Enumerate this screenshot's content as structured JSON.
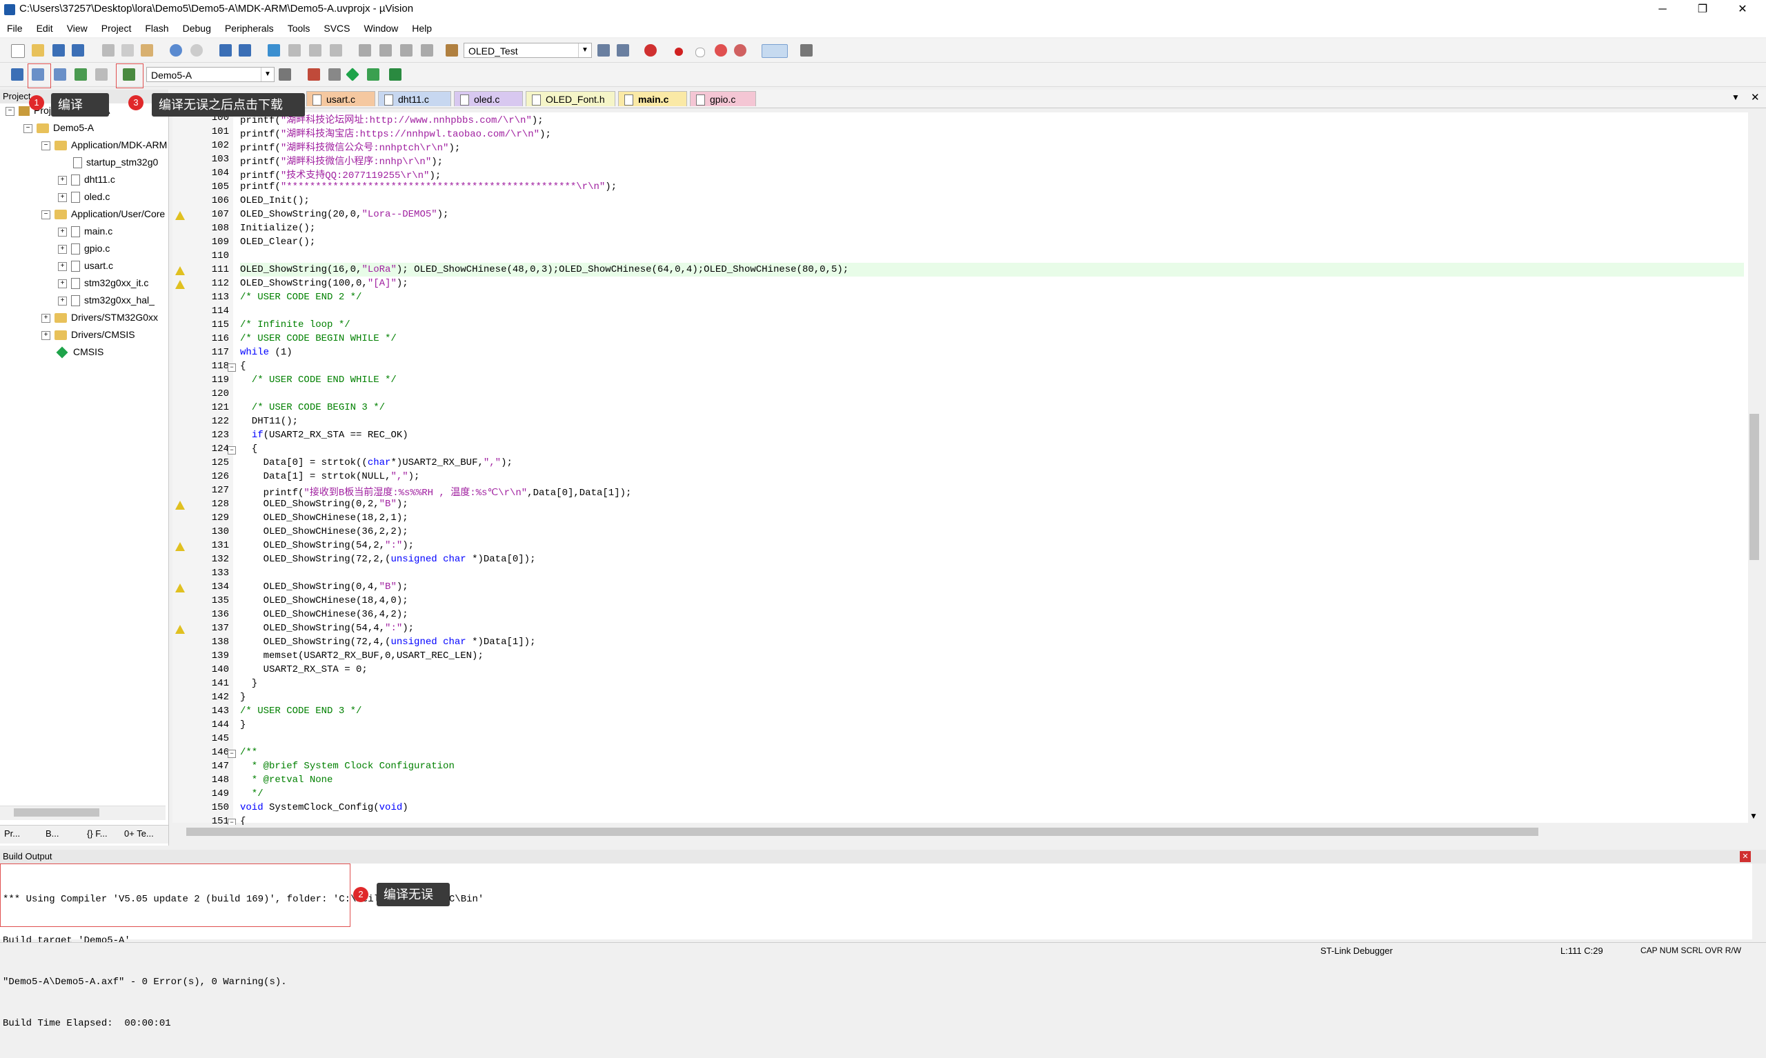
{
  "window": {
    "title": "C:\\Users\\37257\\Desktop\\lora\\Demo5\\Demo5-A\\MDK-ARM\\Demo5-A.uvprojx - µVision",
    "minimize": "─",
    "maximize": "❐",
    "close": "✕"
  },
  "menu": [
    "File",
    "Edit",
    "View",
    "Project",
    "Flash",
    "Debug",
    "Peripherals",
    "Tools",
    "SVCS",
    "Window",
    "Help"
  ],
  "toolbar1": {
    "target_combo": "OLED_Test"
  },
  "toolbar2": {
    "project_combo": "Demo5-A"
  },
  "project_panel": {
    "header": "Project",
    "tree": [
      {
        "label": "Project: Demo5-A",
        "level": 0,
        "type": "project"
      },
      {
        "label": "Demo5-A",
        "level": 1,
        "type": "folder"
      },
      {
        "label": "Application/MDK-ARM",
        "level": 2,
        "type": "folder"
      },
      {
        "label": "startup_stm32g0",
        "level": 3,
        "type": "file"
      },
      {
        "label": "dht11.c",
        "level": 3,
        "type": "file"
      },
      {
        "label": "oled.c",
        "level": 3,
        "type": "file"
      },
      {
        "label": "Application/User/Core",
        "level": 2,
        "type": "folder"
      },
      {
        "label": "main.c",
        "level": 3,
        "type": "file"
      },
      {
        "label": "gpio.c",
        "level": 3,
        "type": "file"
      },
      {
        "label": "usart.c",
        "level": 3,
        "type": "file"
      },
      {
        "label": "stm32g0xx_it.c",
        "level": 3,
        "type": "file"
      },
      {
        "label": "stm32g0xx_hal_",
        "level": 3,
        "type": "file"
      },
      {
        "label": "Drivers/STM32G0xx",
        "level": 2,
        "type": "folder"
      },
      {
        "label": "Drivers/CMSIS",
        "level": 2,
        "type": "folder"
      },
      {
        "label": "CMSIS",
        "level": 2,
        "type": "cmsis"
      }
    ],
    "bottom_tabs": [
      "Pr...",
      "B...",
      "{} F...",
      "0+ Te..."
    ]
  },
  "editor_tabs": [
    {
      "label": "usart.c",
      "color": "#f5c8a0",
      "active": false
    },
    {
      "label": "dht11.c",
      "color": "#c7d7f0",
      "active": false
    },
    {
      "label": "oled.c",
      "color": "#d8c8f0",
      "active": false
    },
    {
      "label": "OLED_Font.h",
      "color": "#f5f5c8",
      "active": false
    },
    {
      "label": "main.c",
      "color": "#fae9a6",
      "active": true
    },
    {
      "label": "gpio.c",
      "color": "#f4c6d4",
      "active": false
    }
  ],
  "code_lines": [
    {
      "n": "100",
      "text": "printf(\"湖畔科技论坛网址:http://www.nnhpbbs.com/\\r\\n\");",
      "warn": false
    },
    {
      "n": "101",
      "text": "printf(\"湖畔科技淘宝店:https://nnhpwl.taobao.com/\\r\\n\");",
      "warn": false
    },
    {
      "n": "102",
      "text": "printf(\"湖畔科技微信公众号:nnhptch\\r\\n\");",
      "warn": false
    },
    {
      "n": "103",
      "text": "printf(\"湖畔科技微信小程序:nnhp\\r\\n\");",
      "warn": false
    },
    {
      "n": "104",
      "text": "printf(\"技术支持QQ:2077119255\\r\\n\");",
      "warn": false
    },
    {
      "n": "105",
      "text": "printf(\"**************************************************\\r\\n\");",
      "warn": false
    },
    {
      "n": "106",
      "text": "OLED_Init();",
      "warn": false
    },
    {
      "n": "107",
      "text": "OLED_ShowString(20,0,\"Lora--DEMO5\");",
      "warn": true
    },
    {
      "n": "108",
      "text": "Initialize();",
      "warn": false
    },
    {
      "n": "109",
      "text": "OLED_Clear();",
      "warn": false
    },
    {
      "n": "110",
      "text": "",
      "warn": false
    },
    {
      "n": "111",
      "text": "OLED_ShowString(16,0,\"LoRa\"); OLED_ShowCHinese(48,0,3);OLED_ShowCHinese(64,0,4);OLED_ShowCHinese(80,0,5);",
      "warn": true
    },
    {
      "n": "112",
      "text": "OLED_ShowString(100,0,\"[A]\");",
      "warn": true
    },
    {
      "n": "113",
      "text": "/* USER CODE END 2 */",
      "warn": false
    },
    {
      "n": "114",
      "text": "",
      "warn": false
    },
    {
      "n": "115",
      "text": "/* Infinite loop */",
      "warn": false
    },
    {
      "n": "116",
      "text": "/* USER CODE BEGIN WHILE */",
      "warn": false
    },
    {
      "n": "117",
      "text": "while (1)",
      "warn": false
    },
    {
      "n": "118",
      "text": "{",
      "warn": false
    },
    {
      "n": "119",
      "text": "  /* USER CODE END WHILE */",
      "warn": false
    },
    {
      "n": "120",
      "text": "",
      "warn": false
    },
    {
      "n": "121",
      "text": "  /* USER CODE BEGIN 3 */",
      "warn": false
    },
    {
      "n": "122",
      "text": "  DHT11();",
      "warn": false
    },
    {
      "n": "123",
      "text": "  if(USART2_RX_STA == REC_OK)",
      "warn": false
    },
    {
      "n": "124",
      "text": "  {",
      "warn": false
    },
    {
      "n": "125",
      "text": "    Data[0] = strtok((char*)USART2_RX_BUF,\",\");",
      "warn": false
    },
    {
      "n": "126",
      "text": "    Data[1] = strtok(NULL,\",\");",
      "warn": false
    },
    {
      "n": "127",
      "text": "    printf(\"接收到B板当前湿度:%s%%RH , 温度:%s℃\\r\\n\",Data[0],Data[1]);",
      "warn": false
    },
    {
      "n": "128",
      "text": "    OLED_ShowString(0,2,\"B\");",
      "warn": true
    },
    {
      "n": "129",
      "text": "    OLED_ShowCHinese(18,2,1);",
      "warn": false
    },
    {
      "n": "130",
      "text": "    OLED_ShowCHinese(36,2,2);",
      "warn": false
    },
    {
      "n": "131",
      "text": "    OLED_ShowString(54,2,\":\");",
      "warn": true
    },
    {
      "n": "132",
      "text": "    OLED_ShowString(72,2,(unsigned char *)Data[0]);",
      "warn": false
    },
    {
      "n": "133",
      "text": "",
      "warn": false
    },
    {
      "n": "134",
      "text": "    OLED_ShowString(0,4,\"B\");",
      "warn": true
    },
    {
      "n": "135",
      "text": "    OLED_ShowCHinese(18,4,0);",
      "warn": false
    },
    {
      "n": "136",
      "text": "    OLED_ShowCHinese(36,4,2);",
      "warn": false
    },
    {
      "n": "137",
      "text": "    OLED_ShowString(54,4,\":\");",
      "warn": true
    },
    {
      "n": "138",
      "text": "    OLED_ShowString(72,4,(unsigned char *)Data[1]);",
      "warn": false
    },
    {
      "n": "139",
      "text": "    memset(USART2_RX_BUF,0,USART_REC_LEN);",
      "warn": false
    },
    {
      "n": "140",
      "text": "    USART2_RX_STA = 0;",
      "warn": false
    },
    {
      "n": "141",
      "text": "  }",
      "warn": false
    },
    {
      "n": "142",
      "text": "}",
      "warn": false
    },
    {
      "n": "143",
      "text": "/* USER CODE END 3 */",
      "warn": false
    },
    {
      "n": "144",
      "text": "}",
      "warn": false
    },
    {
      "n": "145",
      "text": "",
      "warn": false
    },
    {
      "n": "146",
      "text": "/**",
      "warn": false
    },
    {
      "n": "147",
      "text": "  * @brief System Clock Configuration",
      "warn": false
    },
    {
      "n": "148",
      "text": "  * @retval None",
      "warn": false
    },
    {
      "n": "149",
      "text": "  */",
      "warn": false
    },
    {
      "n": "150",
      "text": "void SystemClock_Config(void)",
      "warn": false
    },
    {
      "n": "151",
      "text": "{",
      "warn": false
    }
  ],
  "build_output": {
    "header": "Build Output",
    "lines": [
      "*** Using Compiler 'V5.05 update 2 (build 169)', folder: 'C:\\Keil_v5\\ARM\\ARMCC\\Bin'",
      "Build target 'Demo5-A'",
      "\"Demo5-A\\Demo5-A.axf\" - 0 Error(s), 0 Warning(s).",
      "Build Time Elapsed:  00:00:01"
    ]
  },
  "status_bar": {
    "debugger": "ST-Link Debugger",
    "position": "L:111 C:29",
    "flags": "CAP  NUM  SCRL  OVR  R/W"
  },
  "annotations": [
    {
      "badge": "1",
      "text": "编译"
    },
    {
      "badge": "3",
      "text": "编译无误之后点击下载"
    },
    {
      "badge": "2",
      "text": "编译无误"
    }
  ]
}
